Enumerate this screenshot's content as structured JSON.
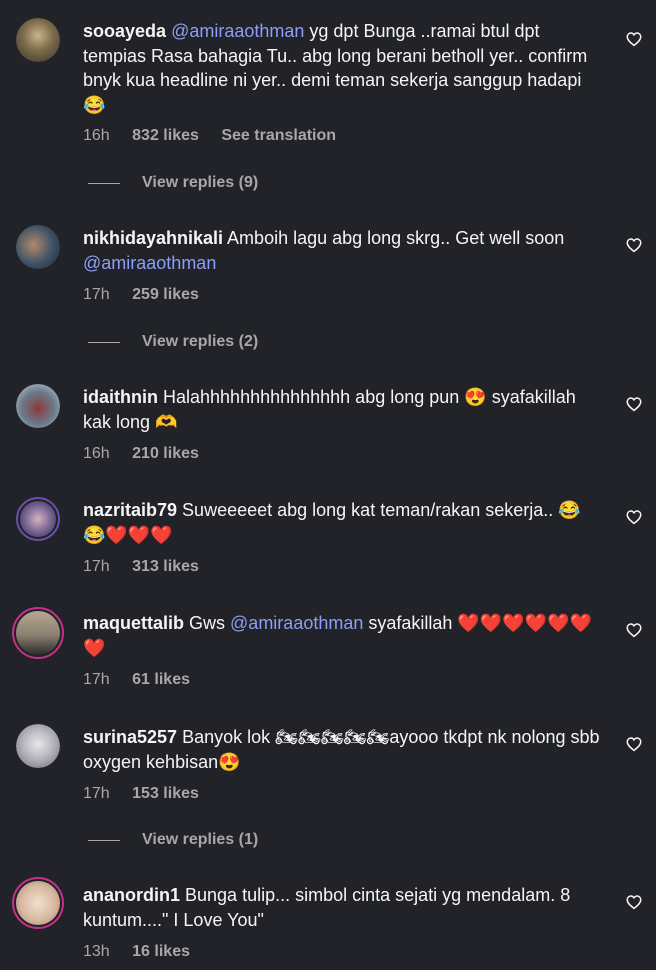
{
  "comments": [
    {
      "username": "sooayeda",
      "mention": "@amiraaothman",
      "text_before": "",
      "text_after": " yg dpt Bunga ..ramai btul dpt tempias Rasa bahagia Tu.. abg long berani betholl yer.. confirm bnyk kua headline ni yer.. demi teman sekerja sanggup hadapi😂",
      "time": "16h",
      "likes": "832 likes",
      "extra": "See translation",
      "replies": "View replies (9)"
    },
    {
      "username": "nikhidayahnikali",
      "text_before": " Amboih lagu abg long skrg.. Get well soon ",
      "mention": "@amiraaothman",
      "text_after": "",
      "time": "17h",
      "likes": "259 likes",
      "replies": "View replies (2)"
    },
    {
      "username": "idaithnin",
      "text": " Halahhhhhhhhhhhhhhh abg long pun 😍 syafakillah kak long 🫶",
      "time": "16h",
      "likes": "210 likes"
    },
    {
      "username": "nazritaib79",
      "text": " Suweeeeet abg long kat teman/rakan sekerja.. 😂😂❤️❤️❤️",
      "time": "17h",
      "likes": "313 likes"
    },
    {
      "username": "maquettalib",
      "text_before": " Gws ",
      "mention": "@amiraaothman",
      "text_after": " syafakillah ❤️❤️❤️❤️❤️❤️❤️",
      "time": "17h",
      "likes": "61 likes"
    },
    {
      "username": "surina5257",
      "text": " Banyok lok 🏍🏍🏍🏍🏍ayooo tkdpt nk nolong sbb oxygen kehbisan😍",
      "time": "17h",
      "likes": "153 likes",
      "replies": "View replies (1)"
    },
    {
      "username": "ananordin1",
      "text": " Bunga tulip... simbol cinta sejati yg mendalam. 8 kuntum....\" I Love You\"",
      "time": "13h",
      "likes": "16 likes"
    }
  ],
  "icons": {
    "like": "heart-outline-icon"
  },
  "colors": {
    "background": "#212328",
    "mention": "#8c9ef5",
    "meta": "#a8a8a8"
  }
}
